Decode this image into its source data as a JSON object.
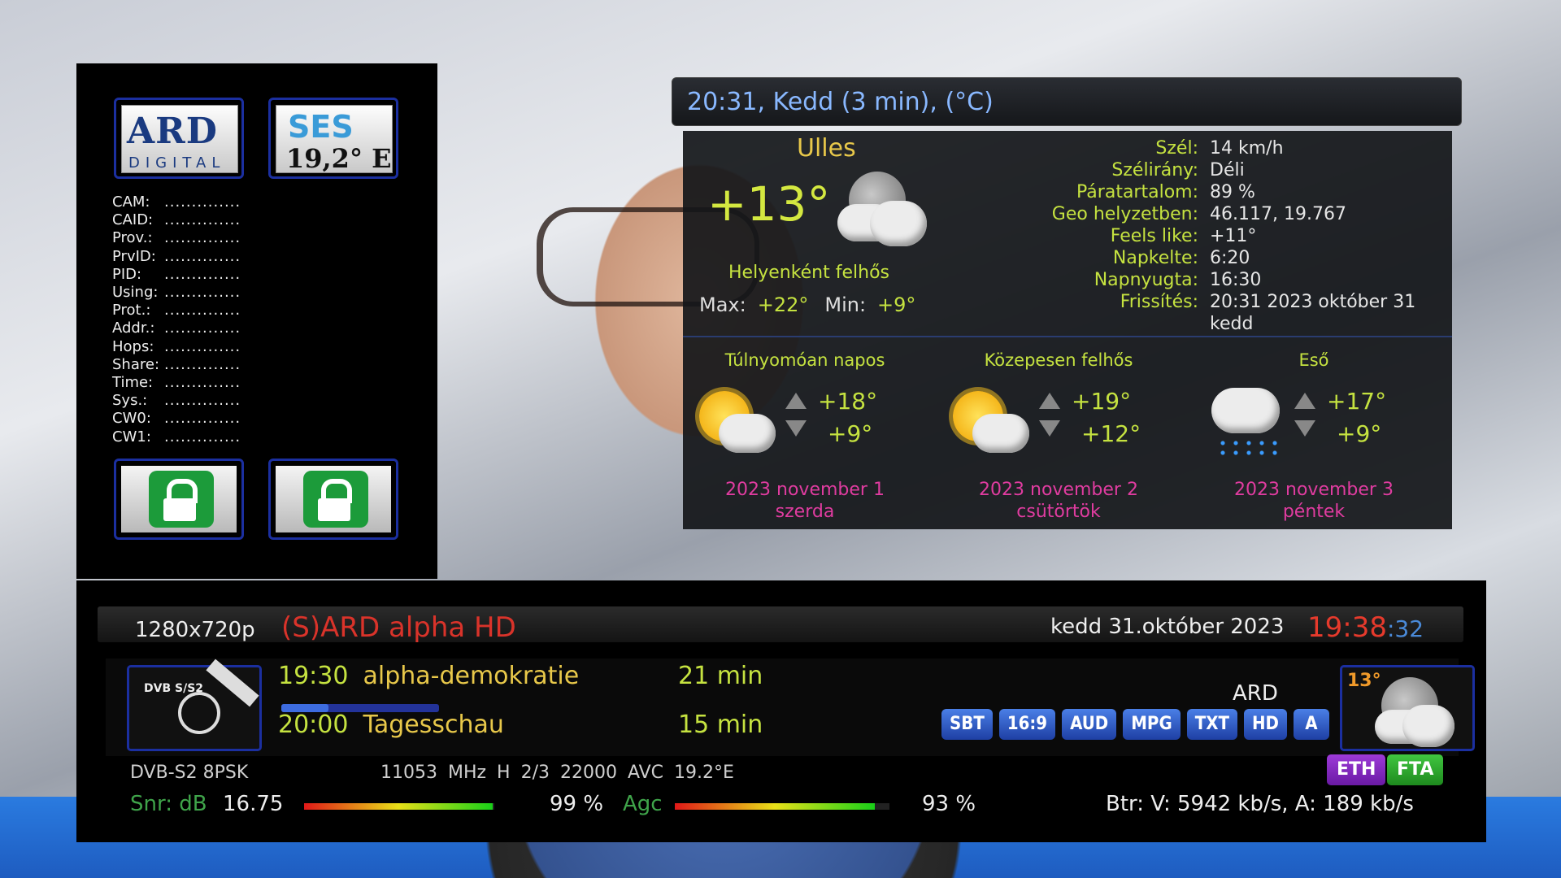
{
  "ecm": {
    "logos": {
      "ard_main": "ARD",
      "ard_sub": "DIGITAL",
      "ses_main": "SES",
      "ses_sub": "19,2° E"
    },
    "rows": [
      {
        "key": "CAM:",
        "value": ".............."
      },
      {
        "key": "CAID:",
        "value": ".............."
      },
      {
        "key": "Prov.:",
        "value": ".............."
      },
      {
        "key": "PrvID:",
        "value": ".............."
      },
      {
        "key": "PID:",
        "value": ".............."
      },
      {
        "key": "Using:",
        "value": ".............."
      },
      {
        "key": "Prot.:",
        "value": ".............."
      },
      {
        "key": "Addr.:",
        "value": ".............."
      },
      {
        "key": "Hops:",
        "value": ".............."
      },
      {
        "key": "Share:",
        "value": ".............."
      },
      {
        "key": "Time:",
        "value": ".............."
      },
      {
        "key": "Sys.:",
        "value": ".............."
      },
      {
        "key": "CW0:",
        "value": ".............."
      },
      {
        "key": "CW1:",
        "value": ".............."
      }
    ]
  },
  "weather": {
    "title": "20:31, Kedd (3 min), (°C)",
    "city": "Ulles",
    "temp": "+13°",
    "desc": "Helyenként felhős",
    "max_label": "Max:",
    "max": "+22°",
    "min_label": "Min:",
    "min": "+9°",
    "details": [
      {
        "key": "Szél:",
        "value": "14 km/h"
      },
      {
        "key": "Szélirány:",
        "value": "Déli"
      },
      {
        "key": "Páratartalom:",
        "value": "89 %"
      },
      {
        "key": "Geo helyzetben:",
        "value": "46.117, 19.767"
      },
      {
        "key": "Feels like:",
        "value": "+11°"
      },
      {
        "key": "Napkelte:",
        "value": "6:20"
      },
      {
        "key": "Napnyugta:",
        "value": "16:30"
      },
      {
        "key": "Frissítés:",
        "value": "20:31 2023 október 31"
      },
      {
        "key": "",
        "value": "kedd"
      }
    ],
    "forecast": [
      {
        "desc": "Túlnyomóan napos",
        "hi": "+18°",
        "lo": "+9°",
        "date": "2023 november 1",
        "day": "szerda",
        "icon": "sun-cloud-icon"
      },
      {
        "desc": "Közepesen felhős",
        "hi": "+19°",
        "lo": "+12°",
        "date": "2023 november 2",
        "day": "csütörtök",
        "icon": "sun-cloud-icon"
      },
      {
        "desc": "Eső",
        "hi": "+17°",
        "lo": "+9°",
        "date": "2023 november 3",
        "day": "péntek",
        "icon": "rain-icon"
      }
    ]
  },
  "infobar": {
    "resolution": "1280x720p",
    "channel": "(S)ARD alpha HD",
    "date": "kedd  31.október 2023",
    "time_hm": "19:38",
    "time_sec": ":32",
    "sat_label": "DVB S/S2",
    "now": {
      "time": "19:30",
      "title": "alpha-demokratie",
      "remaining": "21 min",
      "progress": 0.3
    },
    "next": {
      "time": "20:00",
      "title": "Tagesschau",
      "duration": "15 min"
    },
    "badges": [
      "SBT",
      "16:9",
      "AUD",
      "MPG",
      "TXT",
      "HD",
      "A"
    ],
    "provider": "ARD",
    "mini_temp": "13°",
    "tech": "DVB-S2  8PSK",
    "freq": "11053 MHz  H  2/3  22000  AVC  19.2°E",
    "flags": {
      "eth": "ETH",
      "fta": "FTA"
    },
    "snr_label": "Snr: dB",
    "snr_value": "16.75",
    "snr_percent": "99 %",
    "snr_level": 0.99,
    "agc_label": "Agc",
    "agc_percent": "93 %",
    "agc_level": 0.93,
    "bitrate": "Btr: V: 5942 kb/s, A: 189 kb/s"
  }
}
